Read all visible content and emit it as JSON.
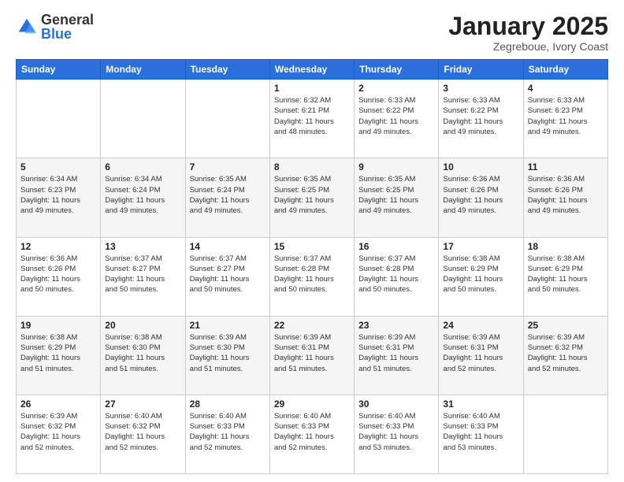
{
  "header": {
    "logo_general": "General",
    "logo_blue": "Blue",
    "title": "January 2025",
    "location": "Zegreboue, Ivory Coast"
  },
  "weekdays": [
    "Sunday",
    "Monday",
    "Tuesday",
    "Wednesday",
    "Thursday",
    "Friday",
    "Saturday"
  ],
  "weeks": [
    [
      {
        "day": "",
        "info": ""
      },
      {
        "day": "",
        "info": ""
      },
      {
        "day": "",
        "info": ""
      },
      {
        "day": "1",
        "info": "Sunrise: 6:32 AM\nSunset: 6:21 PM\nDaylight: 11 hours\nand 48 minutes."
      },
      {
        "day": "2",
        "info": "Sunrise: 6:33 AM\nSunset: 6:22 PM\nDaylight: 11 hours\nand 49 minutes."
      },
      {
        "day": "3",
        "info": "Sunrise: 6:33 AM\nSunset: 6:22 PM\nDaylight: 11 hours\nand 49 minutes."
      },
      {
        "day": "4",
        "info": "Sunrise: 6:33 AM\nSunset: 6:23 PM\nDaylight: 11 hours\nand 49 minutes."
      }
    ],
    [
      {
        "day": "5",
        "info": "Sunrise: 6:34 AM\nSunset: 6:23 PM\nDaylight: 11 hours\nand 49 minutes."
      },
      {
        "day": "6",
        "info": "Sunrise: 6:34 AM\nSunset: 6:24 PM\nDaylight: 11 hours\nand 49 minutes."
      },
      {
        "day": "7",
        "info": "Sunrise: 6:35 AM\nSunset: 6:24 PM\nDaylight: 11 hours\nand 49 minutes."
      },
      {
        "day": "8",
        "info": "Sunrise: 6:35 AM\nSunset: 6:25 PM\nDaylight: 11 hours\nand 49 minutes."
      },
      {
        "day": "9",
        "info": "Sunrise: 6:35 AM\nSunset: 6:25 PM\nDaylight: 11 hours\nand 49 minutes."
      },
      {
        "day": "10",
        "info": "Sunrise: 6:36 AM\nSunset: 6:26 PM\nDaylight: 11 hours\nand 49 minutes."
      },
      {
        "day": "11",
        "info": "Sunrise: 6:36 AM\nSunset: 6:26 PM\nDaylight: 11 hours\nand 49 minutes."
      }
    ],
    [
      {
        "day": "12",
        "info": "Sunrise: 6:36 AM\nSunset: 6:26 PM\nDaylight: 11 hours\nand 50 minutes."
      },
      {
        "day": "13",
        "info": "Sunrise: 6:37 AM\nSunset: 6:27 PM\nDaylight: 11 hours\nand 50 minutes."
      },
      {
        "day": "14",
        "info": "Sunrise: 6:37 AM\nSunset: 6:27 PM\nDaylight: 11 hours\nand 50 minutes."
      },
      {
        "day": "15",
        "info": "Sunrise: 6:37 AM\nSunset: 6:28 PM\nDaylight: 11 hours\nand 50 minutes."
      },
      {
        "day": "16",
        "info": "Sunrise: 6:37 AM\nSunset: 6:28 PM\nDaylight: 11 hours\nand 50 minutes."
      },
      {
        "day": "17",
        "info": "Sunrise: 6:38 AM\nSunset: 6:29 PM\nDaylight: 11 hours\nand 50 minutes."
      },
      {
        "day": "18",
        "info": "Sunrise: 6:38 AM\nSunset: 6:29 PM\nDaylight: 11 hours\nand 50 minutes."
      }
    ],
    [
      {
        "day": "19",
        "info": "Sunrise: 6:38 AM\nSunset: 6:29 PM\nDaylight: 11 hours\nand 51 minutes."
      },
      {
        "day": "20",
        "info": "Sunrise: 6:38 AM\nSunset: 6:30 PM\nDaylight: 11 hours\nand 51 minutes."
      },
      {
        "day": "21",
        "info": "Sunrise: 6:39 AM\nSunset: 6:30 PM\nDaylight: 11 hours\nand 51 minutes."
      },
      {
        "day": "22",
        "info": "Sunrise: 6:39 AM\nSunset: 6:31 PM\nDaylight: 11 hours\nand 51 minutes."
      },
      {
        "day": "23",
        "info": "Sunrise: 6:39 AM\nSunset: 6:31 PM\nDaylight: 11 hours\nand 51 minutes."
      },
      {
        "day": "24",
        "info": "Sunrise: 6:39 AM\nSunset: 6:31 PM\nDaylight: 11 hours\nand 52 minutes."
      },
      {
        "day": "25",
        "info": "Sunrise: 6:39 AM\nSunset: 6:32 PM\nDaylight: 11 hours\nand 52 minutes."
      }
    ],
    [
      {
        "day": "26",
        "info": "Sunrise: 6:39 AM\nSunset: 6:32 PM\nDaylight: 11 hours\nand 52 minutes."
      },
      {
        "day": "27",
        "info": "Sunrise: 6:40 AM\nSunset: 6:32 PM\nDaylight: 11 hours\nand 52 minutes."
      },
      {
        "day": "28",
        "info": "Sunrise: 6:40 AM\nSunset: 6:33 PM\nDaylight: 11 hours\nand 52 minutes."
      },
      {
        "day": "29",
        "info": "Sunrise: 6:40 AM\nSunset: 6:33 PM\nDaylight: 11 hours\nand 52 minutes."
      },
      {
        "day": "30",
        "info": "Sunrise: 6:40 AM\nSunset: 6:33 PM\nDaylight: 11 hours\nand 53 minutes."
      },
      {
        "day": "31",
        "info": "Sunrise: 6:40 AM\nSunset: 6:33 PM\nDaylight: 11 hours\nand 53 minutes."
      },
      {
        "day": "",
        "info": ""
      }
    ]
  ]
}
